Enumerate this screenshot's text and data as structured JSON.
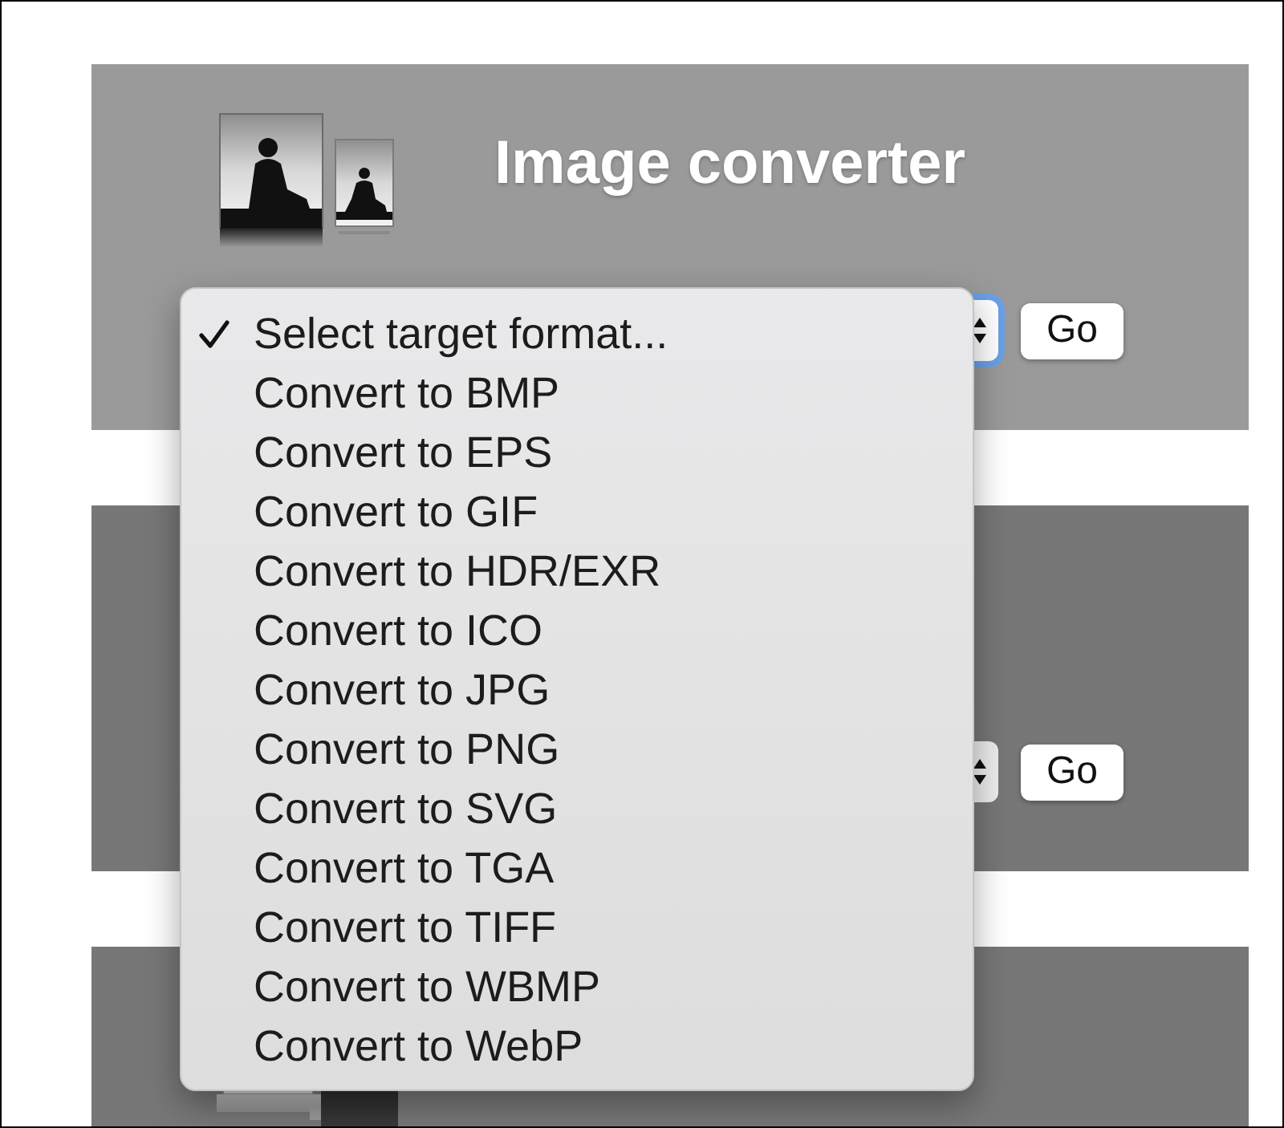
{
  "panels": [
    {
      "highlighted": true,
      "icon": true,
      "title": "Image converter",
      "select": {
        "focused": true
      },
      "button": "Go"
    },
    {
      "highlighted": false,
      "select": {
        "focused": false
      },
      "button": "Go"
    },
    {
      "highlighted": false,
      "icon": true
    }
  ],
  "dropdown_menu": {
    "options": [
      {
        "label": "Select target format...",
        "selected": true
      },
      {
        "label": "Convert to BMP",
        "selected": false
      },
      {
        "label": "Convert to EPS",
        "selected": false
      },
      {
        "label": "Convert to GIF",
        "selected": false
      },
      {
        "label": "Convert to HDR/EXR",
        "selected": false
      },
      {
        "label": "Convert to ICO",
        "selected": false
      },
      {
        "label": "Convert to JPG",
        "selected": false
      },
      {
        "label": "Convert to PNG",
        "selected": false
      },
      {
        "label": "Convert to SVG",
        "selected": false
      },
      {
        "label": "Convert to TGA",
        "selected": false
      },
      {
        "label": "Convert to TIFF",
        "selected": false
      },
      {
        "label": "Convert to WBMP",
        "selected": false
      },
      {
        "label": "Convert to WebP",
        "selected": false
      }
    ]
  }
}
